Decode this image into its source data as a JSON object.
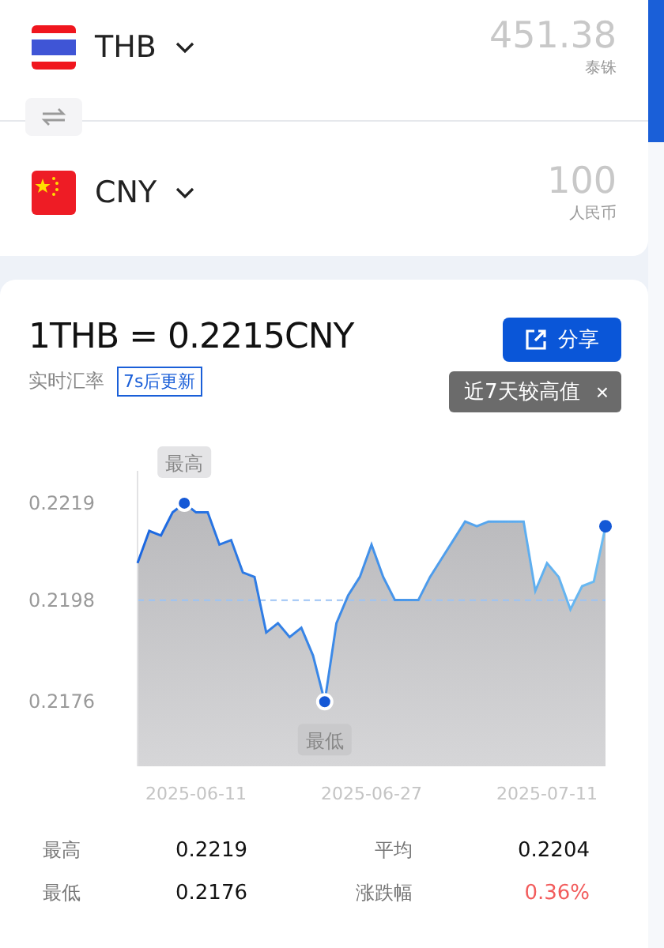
{
  "converter": {
    "currencies": [
      {
        "code": "THB",
        "amount": "451.38",
        "name": "泰铢",
        "kind": "thailand"
      },
      {
        "code": "CNY",
        "amount": "100",
        "name": "人民币",
        "kind": "china"
      }
    ]
  },
  "rate": {
    "title": "1THB = 0.2215CNY",
    "subtitle": "实时汇率",
    "countdown": "7s后更新",
    "share_button": "分享",
    "tooltip": {
      "text": "近7天较高值",
      "close": "×"
    },
    "chart_data": {
      "type": "area",
      "categories": [
        null,
        null,
        null,
        null,
        null,
        "2025-06-11",
        null,
        null,
        null,
        null,
        null,
        null,
        null,
        null,
        null,
        null,
        null,
        null,
        null,
        null,
        "2025-06-27",
        null,
        null,
        null,
        null,
        null,
        null,
        null,
        null,
        null,
        null,
        null,
        null,
        null,
        null,
        "2025-07-11",
        null,
        null,
        null,
        null,
        null
      ],
      "series": [
        {
          "color": "#1a66e0",
          "values": [
            0.2206,
            0.2213,
            0.2212,
            0.2217,
            0.2219,
            0.2217,
            0.2217,
            0.221,
            0.2211,
            0.2204,
            0.2203,
            0.2191,
            0.2193,
            0.219,
            0.2192,
            0.2186,
            0.2176,
            0.2193,
            0.2199,
            0.2203,
            0.221,
            0.2203,
            0.2198,
            0.2198,
            0.2198,
            0.2203,
            0.2207,
            0.2211,
            0.2215,
            0.2214,
            0.2215,
            0.2215,
            0.2215,
            0.2215,
            0.22,
            0.2206,
            0.2203,
            0.2196,
            0.2201,
            0.2202,
            0.2214
          ]
        }
      ],
      "ylim": [
        0.2162,
        0.2226
      ],
      "yticks": [
        0.2176,
        0.2198,
        0.2219
      ],
      "ref_lines": [
        {
          "axis": "y",
          "value": 0.2198
        }
      ],
      "annotations": [
        {
          "text": "最高",
          "y": 0.2219
        },
        {
          "text": "最低",
          "y": 0.2176
        }
      ]
    }
  },
  "stats": [
    {
      "label": "最高",
      "value": "0.2219",
      "kind": "plain"
    },
    {
      "label": "平均",
      "value": "0.2204",
      "kind": "plain"
    },
    {
      "label": "最低",
      "value": "0.2176",
      "kind": "plain"
    },
    {
      "label": "涨跌幅",
      "value": "0.36%",
      "kind": "change"
    }
  ]
}
